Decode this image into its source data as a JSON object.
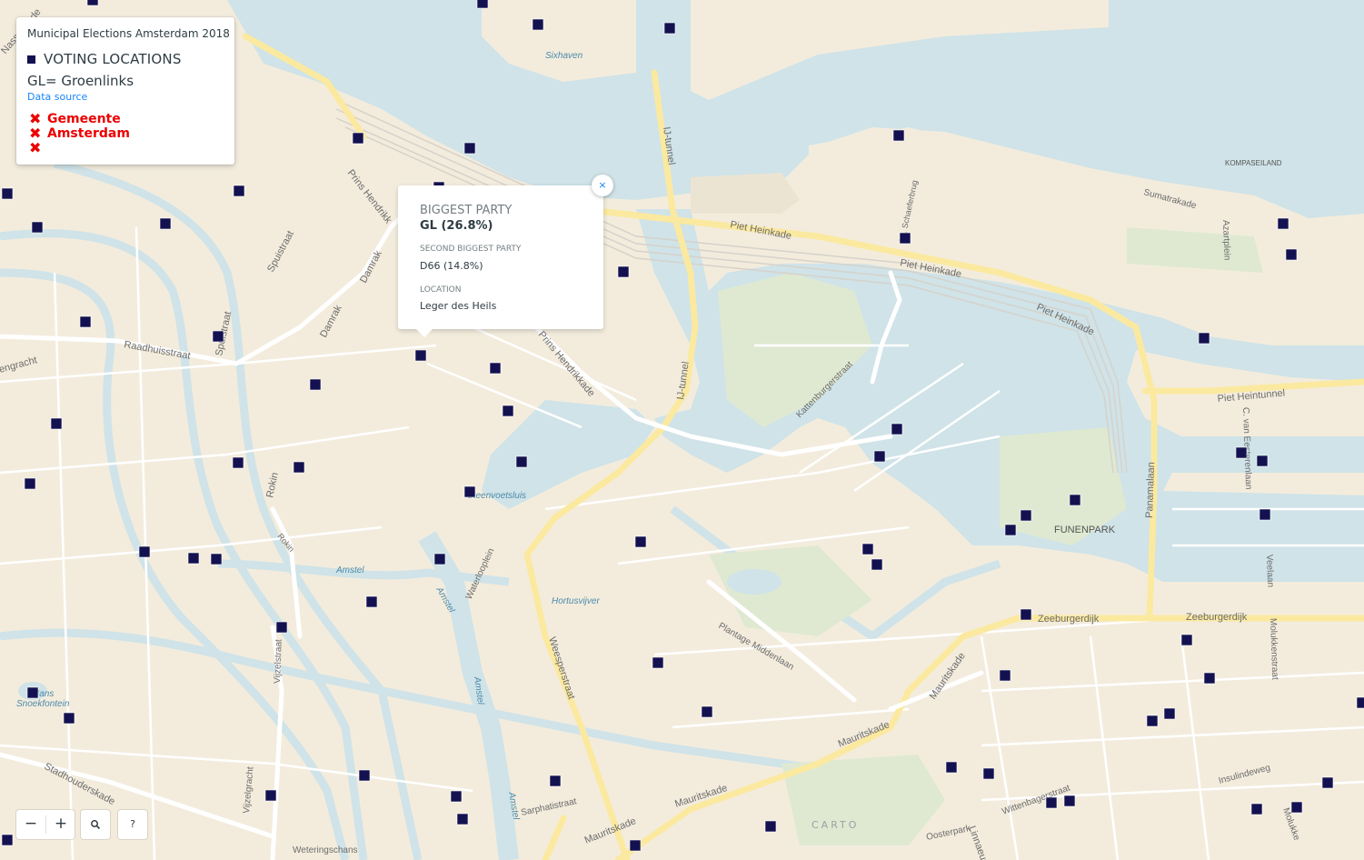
{
  "panel": {
    "title": "Municipal Elections Amsterdam 2018",
    "legend_label": "VOTING LOCATIONS",
    "legend_color": "#13114f",
    "note": "GL= Groenlinks",
    "data_source": "Data source",
    "logo_lines": [
      "Gemeente",
      "Amsterdam",
      ""
    ]
  },
  "popup": {
    "biggest_party_heading": "BIGGEST PARTY",
    "biggest_party_value": "GL (26.8%)",
    "second_party_heading": "SECOND BIGGEST PARTY",
    "second_party_value": "D66 (14.8%)",
    "location_heading": "LOCATION",
    "location_value": "Leger des Heils",
    "close": "×"
  },
  "controls": {
    "zoom_out": "−",
    "zoom_in": "+",
    "search": "search-icon",
    "help": "?"
  },
  "attribution": "CARTO",
  "map_labels": {
    "streets": [
      "Piet Heinkade",
      "Piet Heinkade",
      "Piet Heinkade",
      "IJ-tunnel",
      "IJ-tunnel",
      "Prins Hendrikkade",
      "Prins Hendrikkade",
      "Damrak",
      "Damrak",
      "Spuistraat",
      "Spuistraat",
      "Raadhuisstraat",
      "Rokin",
      "Rokin",
      "Amstel",
      "Amstel",
      "Amstel",
      "Waterlooplein",
      "Weesperstraat",
      "Plantage Middenlaan",
      "Kattenburgerstraat",
      "Mauritskade",
      "Mauritskade",
      "Mauritskade",
      "Zeeburgerdijk",
      "Zeeburgerdijk",
      "Panamalaan",
      "Piet Heintunnel",
      "C. van Eesterenlaan",
      "Azartplein",
      "Sumatrakade",
      "Vijzelstraat",
      "Vijzelgracht",
      "Stadhouderskade",
      "Sarphatistraat",
      "Wittenburgergracht",
      "Insulindeweg",
      "Molukkenstraat",
      "Veelaan",
      "Oosterpark",
      "Weteringschans",
      "J.J. Schaeferbrug",
      "Linnaeus",
      "Prins Hendrikk",
      "Nassaukade",
      "engracht"
    ],
    "areas": [
      "FUNENPARK",
      "KOMPASEILAND"
    ],
    "water": [
      "Sixhaven",
      "Steenvoetsluis",
      "Hortusvijver",
      "Hans Snoekfontein"
    ]
  },
  "colors": {
    "water": "#cfe3e8",
    "land": "#f3ecdd",
    "road_major": "#fbe9a0",
    "park": "#dfe9d2",
    "marker": "#13114f",
    "accent": "#1785fb",
    "logo_red": "#ec0000"
  }
}
